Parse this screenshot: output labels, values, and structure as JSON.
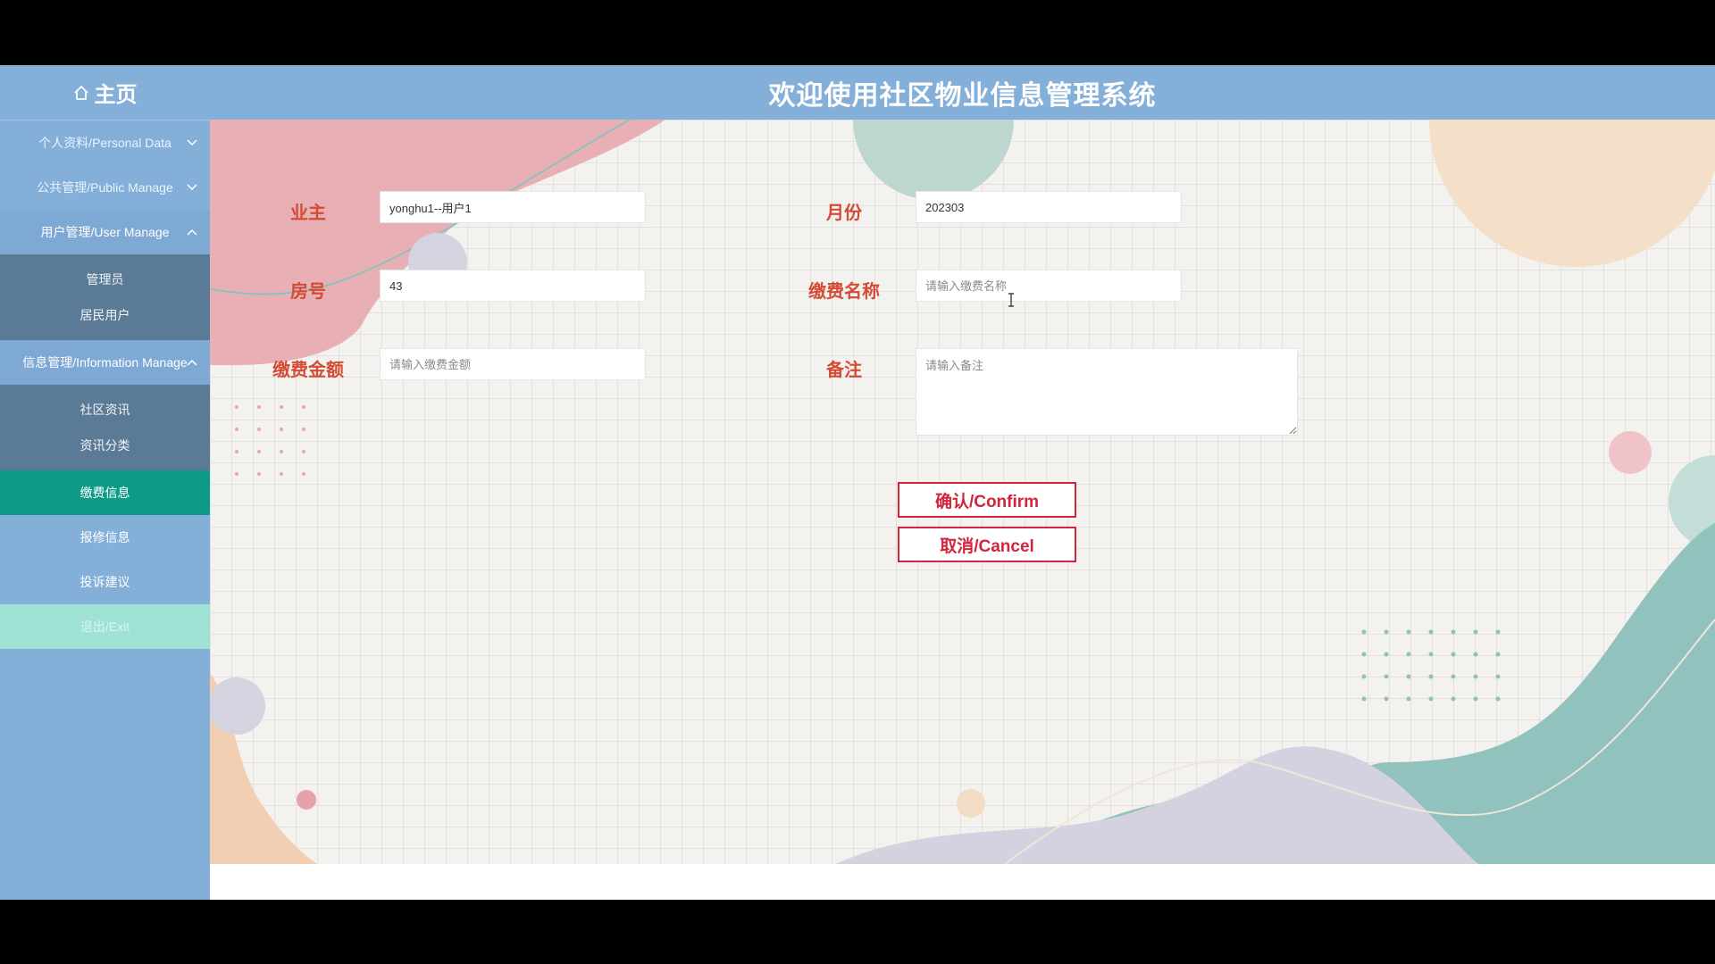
{
  "sidebar": {
    "home_label": "主页",
    "groups": [
      {
        "label": "个人资料/Personal Data",
        "expanded": false
      },
      {
        "label": "公共管理/Public Manage",
        "expanded": false
      },
      {
        "label": "用户管理/User Manage",
        "expanded": true,
        "items": [
          "管理员",
          "居民用户"
        ]
      },
      {
        "label": "信息管理/Information Manage",
        "expanded": true,
        "items": [
          "社区资讯",
          "资讯分类"
        ]
      }
    ],
    "items": [
      "缴费信息",
      "报修信息",
      "投诉建议"
    ],
    "active_item": "缴费信息",
    "exit_label": "退出/Exit"
  },
  "header": {
    "title": "欢迎使用社区物业信息管理系统"
  },
  "form": {
    "owner": {
      "label": "业主",
      "value": "yonghu1--用户1"
    },
    "month": {
      "label": "月份",
      "value": "202303"
    },
    "room": {
      "label": "房号",
      "value": "43"
    },
    "fee_name": {
      "label": "缴费名称",
      "value": "",
      "placeholder": "请输入缴费名称"
    },
    "amount": {
      "label": "缴费金额",
      "value": "",
      "placeholder": "请输入缴费金额"
    },
    "remark": {
      "label": "备注",
      "value": "",
      "placeholder": "请输入备注"
    }
  },
  "buttons": {
    "confirm": "确认/Confirm",
    "cancel": "取消/Cancel"
  },
  "colors": {
    "sidebar": "#83afd9",
    "active": "#0f9a88",
    "label": "#d44b35",
    "button": "#d2253c"
  }
}
